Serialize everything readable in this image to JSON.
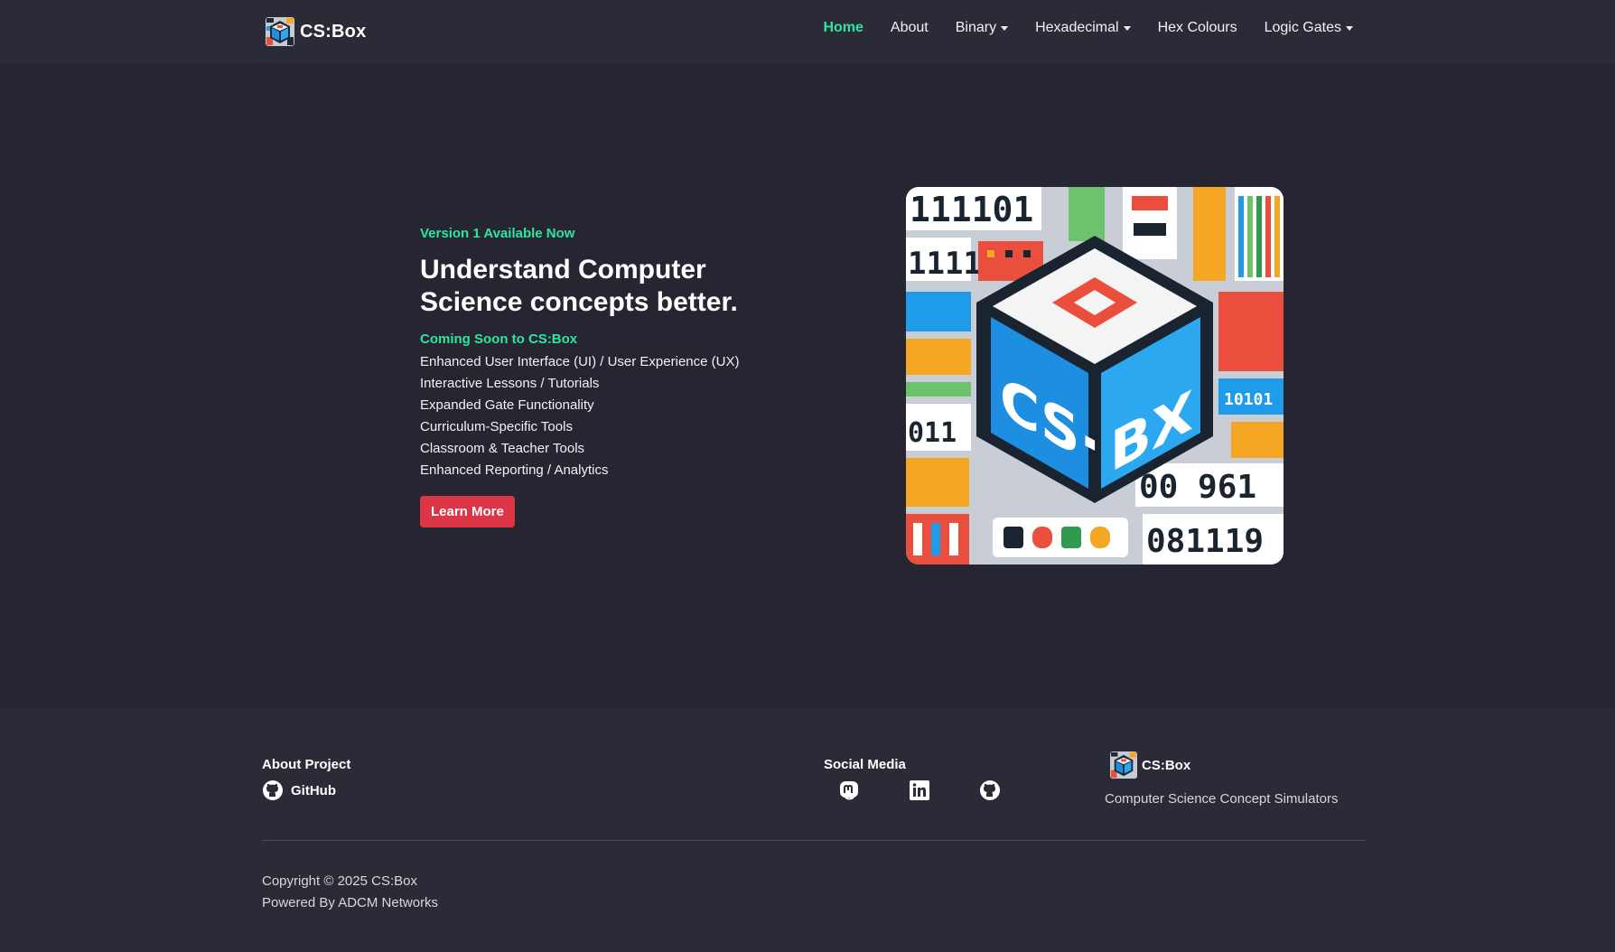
{
  "nav": {
    "brand": "CS:Box",
    "links": [
      {
        "label": "Home",
        "active": true
      },
      {
        "label": "About"
      },
      {
        "label": "Binary",
        "dropdown": true
      },
      {
        "label": "Hexadecimal",
        "dropdown": true
      },
      {
        "label": "Hex Colours"
      },
      {
        "label": "Logic Gates",
        "dropdown": true
      }
    ]
  },
  "hero": {
    "tagline": "Version 1 Available Now",
    "headline_1": "Understand Computer",
    "headline_2": "Science concepts better.",
    "coming_soon": "Coming Soon to CS:Box",
    "features": [
      "Enhanced User Interface (UI) / User Experience (UX)",
      "Interactive Lessons / Tutorials",
      "Expanded Gate Functionality",
      "Curriculum-Specific Tools",
      "Classroom & Teacher Tools",
      "Enhanced Reporting / Analytics"
    ],
    "button": "Learn More",
    "image_text": {
      "top_left_1": "111101",
      "top_left_2": "1111",
      "mid_left": "011",
      "right_mid": "10101",
      "bottom_right_1": "00 961",
      "bottom_right_2": "081119",
      "cube_left": "CS·",
      "cube_right": "BX"
    }
  },
  "footer": {
    "about_title": "About Project",
    "github_label": "GitHub",
    "social_title": "Social Media",
    "social_icons": [
      "mastodon-icon",
      "linkedin-icon",
      "github-icon"
    ],
    "brand_name": "CS:Box",
    "brand_desc": "Computer Science Concept Simulators",
    "copyright": "Copyright © 2025 CS:Box",
    "powered_by": "Powered By ADCM Networks"
  },
  "colors": {
    "background": "#262633",
    "navbar": "#2b2b38",
    "accent": "#2ee59d",
    "button": "#dc3545"
  }
}
